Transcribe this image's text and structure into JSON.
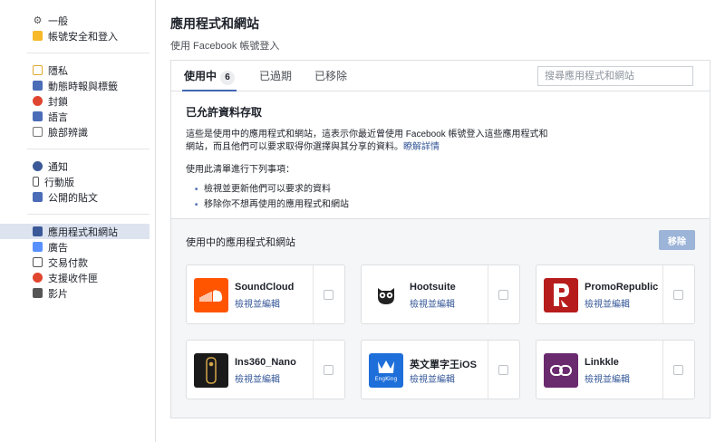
{
  "sidebar": {
    "groups": [
      [
        {
          "label": "一般",
          "icon": "gear-icon"
        },
        {
          "label": "帳號安全和登入",
          "icon": "shield-icon"
        }
      ],
      [
        {
          "label": "隱私",
          "icon": "privacy-lock-icon"
        },
        {
          "label": "動態時報與標籤",
          "icon": "timeline-icon"
        },
        {
          "label": "封鎖",
          "icon": "block-icon"
        },
        {
          "label": "語言",
          "icon": "language-icon"
        },
        {
          "label": "臉部辨識",
          "icon": "face-recognition-icon"
        }
      ],
      [
        {
          "label": "通知",
          "icon": "globe-icon"
        },
        {
          "label": "行動版",
          "icon": "mobile-icon"
        },
        {
          "label": "公開的貼文",
          "icon": "rss-icon"
        }
      ],
      [
        {
          "label": "應用程式和網站",
          "icon": "apps-icon",
          "active": true
        },
        {
          "label": "廣告",
          "icon": "ads-icon"
        },
        {
          "label": "交易付款",
          "icon": "payment-icon"
        },
        {
          "label": "支援收件匣",
          "icon": "support-icon"
        },
        {
          "label": "影片",
          "icon": "video-icon"
        }
      ]
    ]
  },
  "page": {
    "title": "應用程式和網站",
    "subtitle": "使用 Facebook 帳號登入"
  },
  "tabs": {
    "active_label": "使用中",
    "active_count": "6",
    "expired_label": "已過期",
    "removed_label": "已移除"
  },
  "search": {
    "placeholder": "搜尋應用程式和網站"
  },
  "allowed": {
    "title": "已允許資料存取",
    "description": "這些是使用中的應用程式和網站，這表示你最近曾使用 Facebook 帳號登入這些應用程式和網站，而且他們可以要求取得你選擇與其分享的資料。",
    "learn_more": "瞭解詳情",
    "todo_title": "使用此清單進行下列事項：",
    "todo_items": [
      "檢視並更新他們可以要求的資料",
      "移除你不想再使用的應用程式和網站"
    ]
  },
  "apps_section": {
    "header": "使用中的應用程式和網站",
    "remove_label": "移除",
    "edit_label": "檢視並編輯",
    "apps": [
      {
        "name": "SoundCloud",
        "icon": "soundcloud-icon",
        "color": "#ff5500"
      },
      {
        "name": "Hootsuite",
        "icon": "hootsuite-owl-icon",
        "color": "#ffffff"
      },
      {
        "name": "PromoRepublic",
        "icon": "promorepublic-icon",
        "color": "#b71c1c"
      },
      {
        "name": "Ins360_Nano",
        "icon": "ins360-nano-icon",
        "color": "#1a1a1a"
      },
      {
        "name": "英文單字王iOS",
        "icon": "engking-icon",
        "color": "#1e6fd9"
      },
      {
        "name": "Linkkle",
        "icon": "linkkle-icon",
        "color": "#6a2a6e"
      }
    ]
  },
  "colors": {
    "accent": "#4267b2",
    "link": "#365899",
    "active_nav_bg": "#dee3f0",
    "remove_button": "#9cb4d8"
  }
}
